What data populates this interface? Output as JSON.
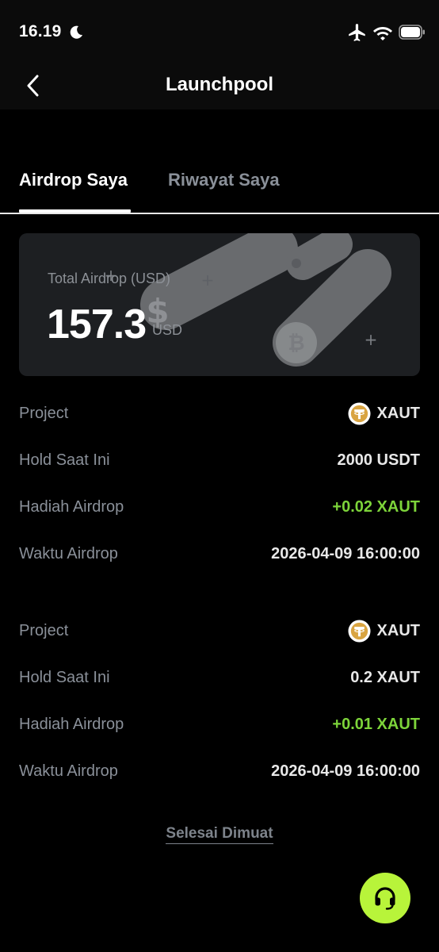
{
  "status_bar": {
    "time": "16.19"
  },
  "nav": {
    "title": "Launchpool"
  },
  "tabs": [
    {
      "label": "Airdrop Saya",
      "active": true
    },
    {
      "label": "Riwayat Saya",
      "active": false
    }
  ],
  "summary": {
    "label": "Total Airdrop (USD)",
    "value": "157.3",
    "unit": "USD"
  },
  "records": [
    {
      "project_label": "Project",
      "project_value": "XAUT",
      "hold_label": "Hold Saat Ini",
      "hold_value": "2000 USDT",
      "reward_label": "Hadiah Airdrop",
      "reward_value": "+0.02 XAUT",
      "time_label": "Waktu Airdrop",
      "time_value": "2026-04-09 16:00:00"
    },
    {
      "project_label": "Project",
      "project_value": "XAUT",
      "hold_label": "Hold Saat Ini",
      "hold_value": "0.2 XAUT",
      "reward_label": "Hadiah Airdrop",
      "reward_value": "+0.01 XAUT",
      "time_label": "Waktu Airdrop",
      "time_value": "2026-04-09 16:00:00"
    }
  ],
  "footer": {
    "load_done": "Selesai Dimuat"
  },
  "icons": {
    "back": "chevron-left-icon",
    "coin": "tether-gold-coin-icon",
    "support": "headset-icon"
  },
  "colors": {
    "background": "#000000",
    "accent": "#b8f43a",
    "positive": "#7dd43a",
    "muted": "#8a9099",
    "card": "#1d1f22"
  }
}
